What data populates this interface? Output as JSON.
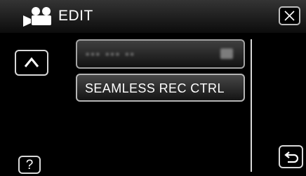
{
  "header": {
    "mode_icon": "video-camera-icon",
    "title": "EDIT",
    "close_icon": "close-x-icon"
  },
  "menu": {
    "items": [
      {
        "label": "▪▪▪ ▪▪▪ ▪▪",
        "state": "obscured",
        "badge_icon": "blurred-badge-icon"
      },
      {
        "label": "SEAMLESS REC CTRL",
        "state": "normal"
      }
    ]
  },
  "controls": {
    "up_icon": "chevron-up-icon",
    "help_label": "?",
    "return_icon": "return-arrow-icon"
  },
  "colors": {
    "background": "#000000",
    "button_border": "#d8d8d8",
    "header_top": "#343434",
    "header_bottom": "#0c0c0c"
  }
}
